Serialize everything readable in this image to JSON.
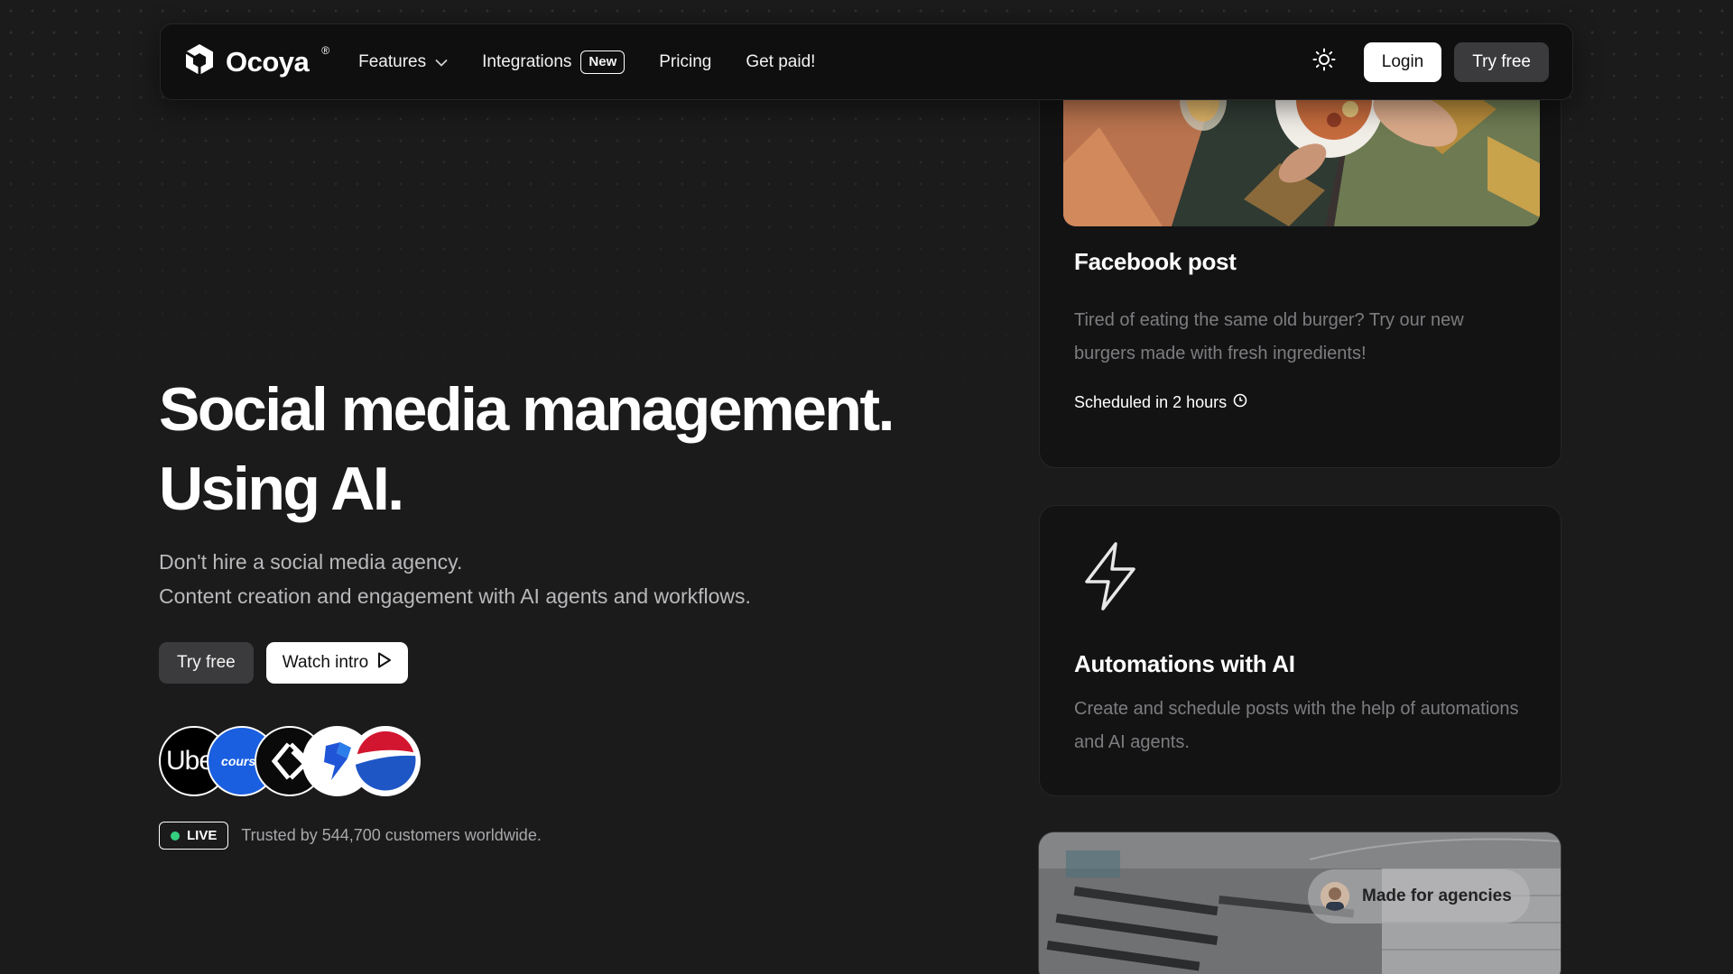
{
  "nav": {
    "brand": "Ocoya",
    "brand_mark": "®",
    "links": {
      "features": "Features",
      "integrations": "Integrations",
      "integrations_badge": "New",
      "pricing": "Pricing",
      "get_paid": "Get paid!"
    },
    "login": "Login",
    "try_free": "Try free",
    "theme_icon": "sun-icon"
  },
  "hero": {
    "title_line1": "Social media management.",
    "title_line2": "Using AI.",
    "subtitle_line1": "Don't hire a social media agency.",
    "subtitle_line2": "Content creation and engagement with AI agents and workflows.",
    "try_free": "Try free",
    "watch_intro": "Watch intro"
  },
  "customers": {
    "logos": [
      "Ube",
      "course",
      "",
      "",
      ""
    ],
    "live": "LIVE",
    "trusted_text": "Trusted by 544,700 customers worldwide."
  },
  "cards": {
    "facebook": {
      "title": "Facebook post",
      "description": "Tired of eating the same old burger? Try our new burgers made with fresh ingredients!",
      "scheduled": "Scheduled in 2 hours"
    },
    "automations": {
      "title": "Automations with AI",
      "description": "Create and schedule posts with the help of automations and AI agents."
    },
    "agencies": {
      "pill": "Made for agencies"
    }
  },
  "colors": {
    "background": "#1b1b1c",
    "card": "#131314",
    "live_dot": "#35d07f",
    "button_dark": "#3b3b3d"
  }
}
